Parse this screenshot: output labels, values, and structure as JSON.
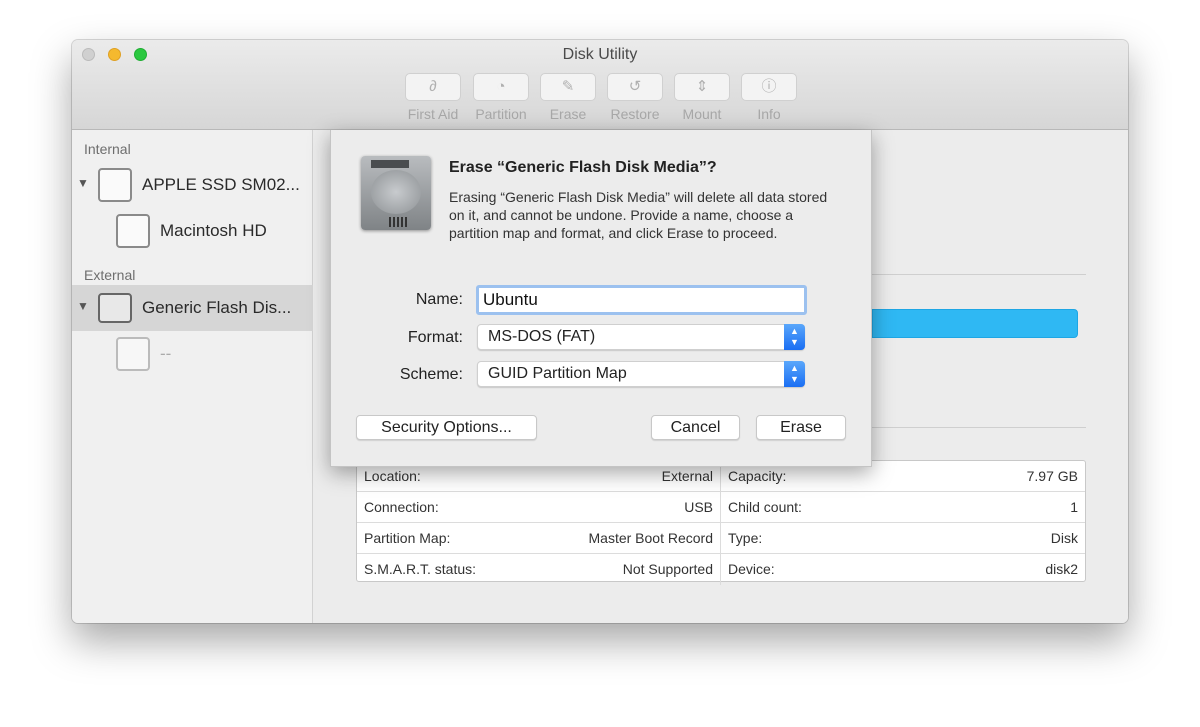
{
  "window": {
    "title": "Disk Utility"
  },
  "toolbar": [
    {
      "label": "First Aid",
      "icon": "stethoscope-icon",
      "glyph": "∂"
    },
    {
      "label": "Partition",
      "icon": "partition-icon",
      "glyph": "◔"
    },
    {
      "label": "Erase",
      "icon": "erase-icon",
      "glyph": "✎"
    },
    {
      "label": "Restore",
      "icon": "restore-icon",
      "glyph": "↺"
    },
    {
      "label": "Mount",
      "icon": "mount-icon",
      "glyph": "⇕"
    },
    {
      "label": "Info",
      "icon": "info-icon",
      "glyph": "ⓘ"
    }
  ],
  "sidebar": {
    "internal_label": "Internal",
    "external_label": "External",
    "items": [
      {
        "label": "APPLE SSD SM02..."
      },
      {
        "label": "Macintosh HD"
      },
      {
        "label": "Generic Flash Dis..."
      },
      {
        "label": "--"
      }
    ]
  },
  "info": {
    "rows": [
      {
        "k1": "Location:",
        "v1": "External",
        "k2": "Capacity:",
        "v2": "7.97 GB"
      },
      {
        "k1": "Connection:",
        "v1": "USB",
        "k2": "Child count:",
        "v2": "1"
      },
      {
        "k1": "Partition Map:",
        "v1": "Master Boot Record",
        "k2": "Type:",
        "v2": "Disk"
      },
      {
        "k1": "S.M.A.R.T. status:",
        "v1": "Not Supported",
        "k2": "Device:",
        "v2": "disk2"
      }
    ]
  },
  "dialog": {
    "title": "Erase “Generic Flash Disk Media”?",
    "message": "Erasing “Generic Flash Disk Media” will delete all data stored on it, and cannot be undone. Provide a name, choose a partition map and format, and click Erase to proceed.",
    "name_label": "Name:",
    "name_value": "Ubuntu",
    "format_label": "Format:",
    "format_value": "MS-DOS (FAT)",
    "scheme_label": "Scheme:",
    "scheme_value": "GUID Partition Map",
    "security_button": "Security Options...",
    "cancel_button": "Cancel",
    "erase_button": "Erase"
  },
  "colors": {
    "accent": "#2fb8f3",
    "select_arrow": "#1a6ef3",
    "close": "#d0d0d0",
    "minimize": "#f5b92e",
    "zoom": "#2bc840"
  }
}
